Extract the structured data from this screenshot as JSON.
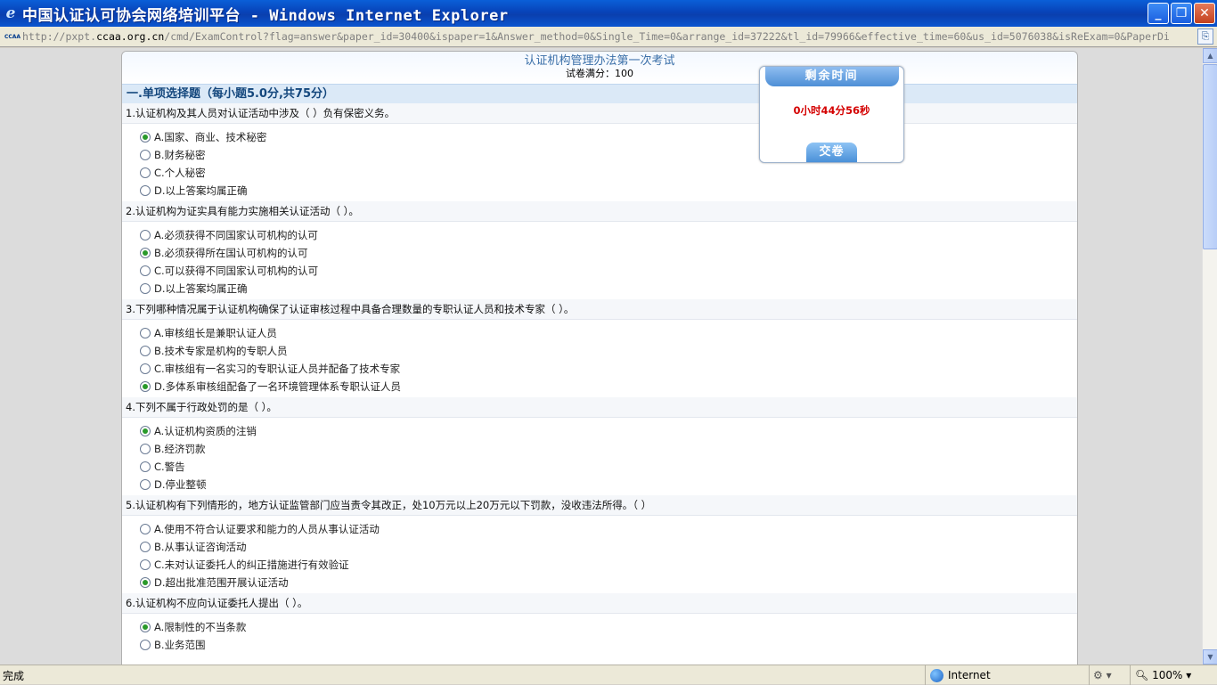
{
  "window": {
    "title": "中国认证认可协会网络培训平台 - Windows Internet Explorer",
    "icon": "ie-icon",
    "minimize_label": "_",
    "maximize_label": "❐",
    "close_label": "✕"
  },
  "address": {
    "favicon_text": "CCAA",
    "scheme": "http://pxpt.",
    "host": "ccaa.org.cn",
    "path": "/cmd/ExamControl?flag=answer&paper_id=30400&ispaper=1&Answer_method=0&Single_Time=0&arrange_id=37222&tl_id=79966&effective_time=60&us_id=5076038&isReExam=0&PaperDi",
    "compat_icon": "compat-view-icon"
  },
  "paper": {
    "title": "认证机构管理办法第一次考试",
    "score": "试卷满分：100",
    "section": "一.单项选择题（每小题5.0分,共75分）",
    "questions": [
      {
        "text": "1.认证机构及其人员对认证活动中涉及（  ）负有保密义务。",
        "options": [
          "A.国家、商业、技术秘密",
          "B.财务秘密",
          "C.个人秘密",
          "D.以上答案均属正确"
        ],
        "selected": 0
      },
      {
        "text": "2.认证机构为证实具有能力实施相关认证活动（  ）。",
        "options": [
          "A.必须获得不同国家认可机构的认可",
          "B.必须获得所在国认可机构的认可",
          "C.可以获得不同国家认可机构的认可",
          "D.以上答案均属正确"
        ],
        "selected": 1
      },
      {
        "text": "3.下列哪种情况属于认证机构确保了认证审核过程中具备合理数量的专职认证人员和技术专家（  ）。",
        "options": [
          "A.审核组长是兼职认证人员",
          "B.技术专家是机构的专职人员",
          "C.审核组有一名实习的专职认证人员并配备了技术专家",
          "D.多体系审核组配备了一名环境管理体系专职认证人员"
        ],
        "selected": 3
      },
      {
        "text": "4.下列不属于行政处罚的是（  ）。",
        "options": [
          "A.认证机构资质的注销",
          "B.经济罚款",
          "C.警告",
          "D.停业整顿"
        ],
        "selected": 0
      },
      {
        "text": "5.认证机构有下列情形的，地方认证监管部门应当责令其改正，处10万元以上20万元以下罚款，没收违法所得。（  ）",
        "options": [
          "A.使用不符合认证要求和能力的人员从事认证活动",
          "B.从事认证咨询活动",
          "C.未对认证委托人的纠正措施进行有效验证",
          "D.超出批准范围开展认证活动"
        ],
        "selected": 3
      },
      {
        "text": "6.认证机构不应向认证委托人提出（  ）。",
        "options": [
          "A.限制性的不当条款",
          "B.业务范围"
        ],
        "selected": 0
      }
    ]
  },
  "timer": {
    "heading": "剩余时间",
    "remaining": "0小时44分56秒",
    "submit_label": "交卷"
  },
  "status": {
    "text": "完成",
    "zone": "Internet",
    "zoom": "100%",
    "protect_icon": "protected-mode-icon"
  }
}
